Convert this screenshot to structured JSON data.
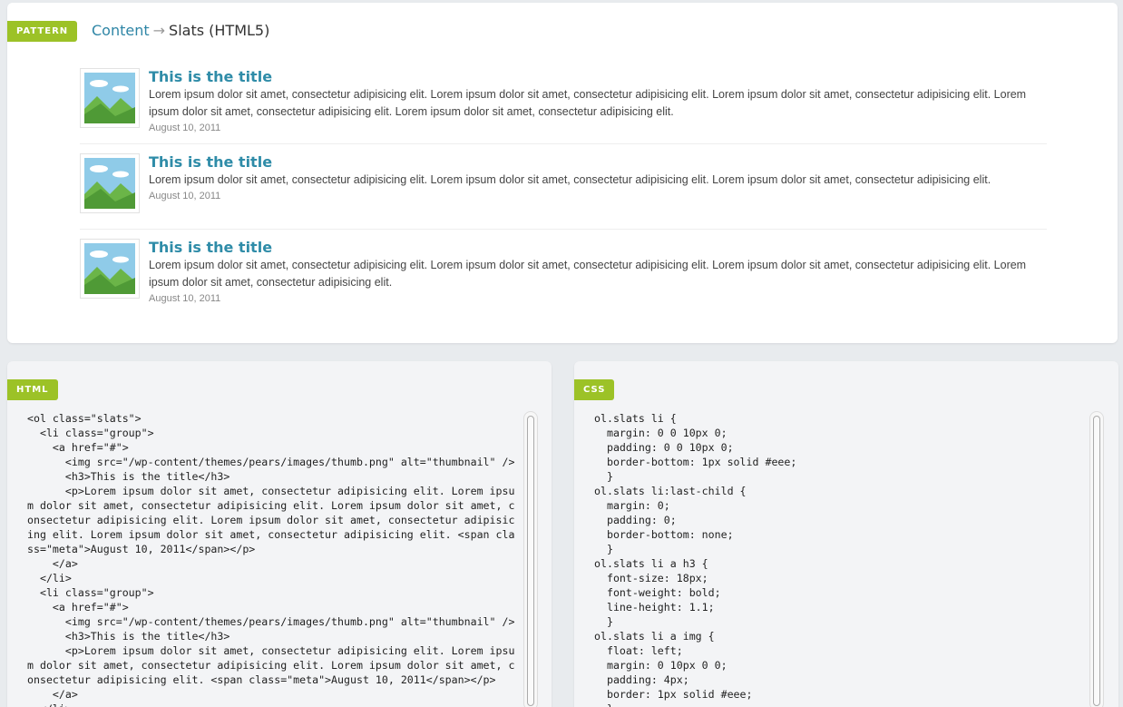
{
  "header": {
    "tag": "PATTERN",
    "breadcrumb_link": "Content",
    "breadcrumb_arrow": "→",
    "breadcrumb_current": "Slats (HTML5)"
  },
  "slats": [
    {
      "title": "This is the title",
      "text": "Lorem ipsum dolor sit amet, consectetur adipisicing elit. Lorem ipsum dolor sit amet, consectetur adipisicing elit. Lorem ipsum dolor sit amet, consectetur adipisicing elit. Lorem ipsum dolor sit amet, consectetur adipisicing elit. Lorem ipsum dolor sit amet, consectetur adipisicing elit.",
      "date": "August 10, 2011"
    },
    {
      "title": "This is the title",
      "text": "Lorem ipsum dolor sit amet, consectetur adipisicing elit. Lorem ipsum dolor sit amet, consectetur adipisicing elit. Lorem ipsum dolor sit amet, consectetur adipisicing elit.",
      "date": "August 10, 2011"
    },
    {
      "title": "This is the title",
      "text": "Lorem ipsum dolor sit amet, consectetur adipisicing elit. Lorem ipsum dolor sit amet, consectetur adipisicing elit. Lorem ipsum dolor sit amet, consectetur adipisicing elit. Lorem ipsum dolor sit amet, consectetur adipisicing elit.",
      "date": "August 10, 2011"
    }
  ],
  "html_panel": {
    "tag": "HTML",
    "code": "<ol class=\"slats\">\n  <li class=\"group\">\n    <a href=\"#\">\n      <img src=\"/wp-content/themes/pears/images/thumb.png\" alt=\"thumbnail\" />\n      <h3>This is the title</h3>\n      <p>Lorem ipsum dolor sit amet, consectetur adipisicing elit. Lorem ipsu\nm dolor sit amet, consectetur adipisicing elit. Lorem ipsum dolor sit amet, c\nonsectetur adipisicing elit. Lorem ipsum dolor sit amet, consectetur adipisic\ning elit. Lorem ipsum dolor sit amet, consectetur adipisicing elit. <span cla\nss=\"meta\">August 10, 2011</span></p>\n    </a>\n  </li>\n  <li class=\"group\">\n    <a href=\"#\">\n      <img src=\"/wp-content/themes/pears/images/thumb.png\" alt=\"thumbnail\" />\n      <h3>This is the title</h3>\n      <p>Lorem ipsum dolor sit amet, consectetur adipisicing elit. Lorem ipsu\nm dolor sit amet, consectetur adipisicing elit. Lorem ipsum dolor sit amet, c\nonsectetur adipisicing elit. <span class=\"meta\">August 10, 2011</span></p>\n    </a>\n  </li>"
  },
  "css_panel": {
    "tag": "CSS",
    "code": "ol.slats li {\n  margin: 0 0 10px 0;\n  padding: 0 0 10px 0;\n  border-bottom: 1px solid #eee;\n  }\nol.slats li:last-child {\n  margin: 0;\n  padding: 0;\n  border-bottom: none;\n  }\nol.slats li a h3 {\n  font-size: 18px;\n  font-weight: bold;\n  line-height: 1.1;\n  }\nol.slats li a img {\n  float: left;\n  margin: 0 10px 0 0;\n  padding: 4px;\n  border: 1px solid #eee;\n  }"
  },
  "colors": {
    "accent": "#9cc227",
    "link": "#2f86a6",
    "title": "#2f8ca8"
  }
}
